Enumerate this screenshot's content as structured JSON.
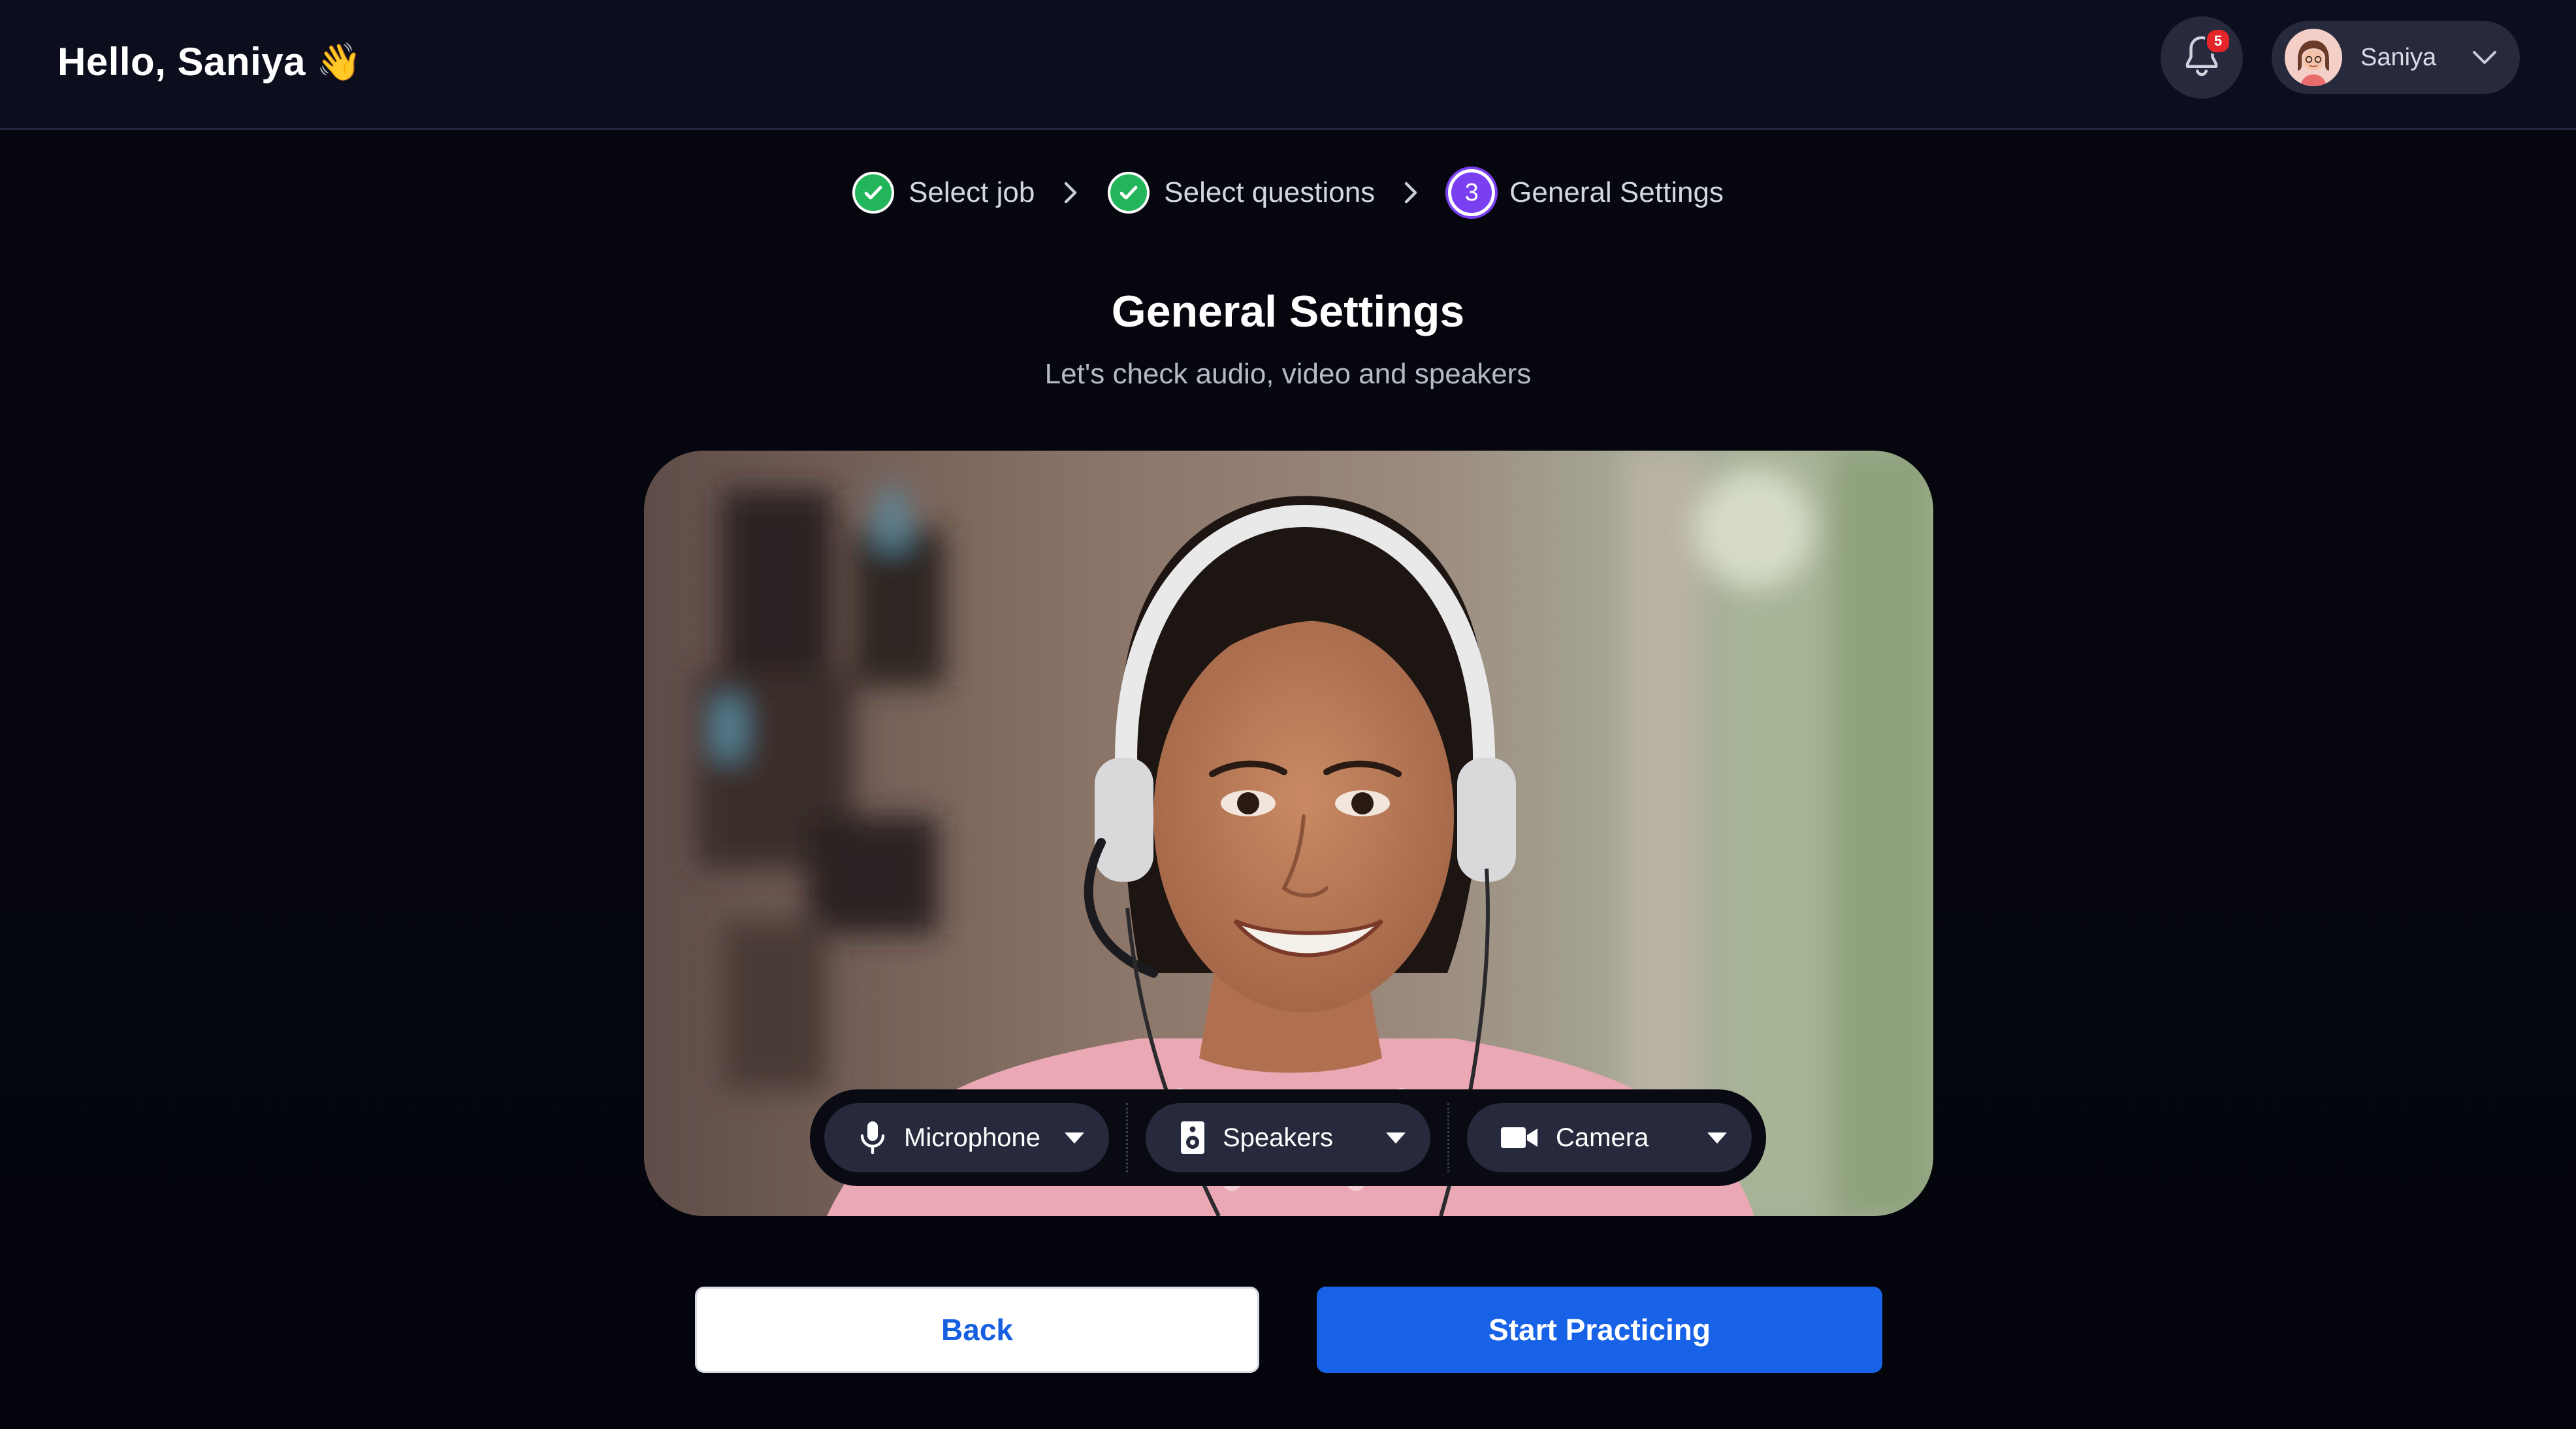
{
  "header": {
    "greeting": "Hello, Saniya",
    "greeting_emoji": "👋",
    "notifications": {
      "count": "5",
      "icon": "bell-icon"
    },
    "user": {
      "name": "Saniya",
      "icon": "avatar"
    }
  },
  "stepper": {
    "steps": [
      {
        "label": "Select job",
        "status": "completed"
      },
      {
        "label": "Select questions",
        "status": "completed"
      },
      {
        "label": "General Settings",
        "status": "current",
        "number": "3"
      }
    ]
  },
  "main": {
    "title": "General Settings",
    "subtitle": "Let's check audio, video and speakers"
  },
  "device_controls": {
    "microphone": {
      "label": "Microphone",
      "icon": "microphone-icon"
    },
    "speakers": {
      "label": "Speakers",
      "icon": "speaker-icon"
    },
    "camera": {
      "label": "Camera",
      "icon": "camera-icon"
    }
  },
  "actions": {
    "back_label": "Back",
    "start_label": "Start Practicing"
  },
  "colors": {
    "background": "#05060d",
    "header": "#0c0e1e",
    "primary": "#1762e6",
    "success": "#22b55a",
    "step_active": "#7b3ff2",
    "notification_badge": "#e5252a"
  }
}
